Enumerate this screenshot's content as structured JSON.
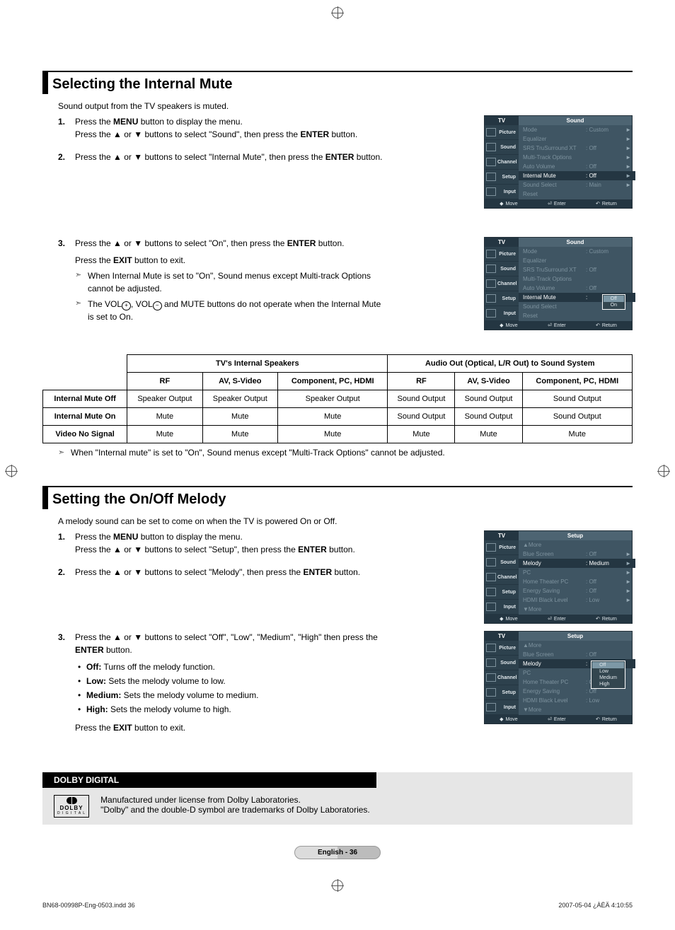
{
  "section1": {
    "title": "Selecting the Internal Mute",
    "intro": "Sound output from the TV speakers is muted.",
    "steps": {
      "s1a": "Press the ",
      "s1b": " button to display the menu.",
      "s1c": "Press the ▲ or ▼ buttons to select \"Sound\", then press the ",
      "s1d": " button.",
      "s2a": "Press the ▲ or ▼ buttons to select \"Internal Mute\", then press the ",
      "s2b": " button.",
      "s3a": "Press the ▲ or ▼ buttons to select \"On\", then press the ",
      "s3b": " button.",
      "s3c": "Press the ",
      "s3d": " button to exit.",
      "note1": "When Internal Mute is set to \"On\", Sound menus except Multi-track Options cannot be adjusted.",
      "note2a": "The VOL",
      "note2b": ", VOL",
      "note2c": " and MUTE buttons do not operate when the Internal Mute is set to On."
    }
  },
  "buttons": {
    "menu": "MENU",
    "enter": "ENTER",
    "exit": "EXIT"
  },
  "osd": {
    "tv": "TV",
    "side": [
      "Picture",
      "Sound",
      "Channel",
      "Setup",
      "Input"
    ],
    "sound_title": "Sound",
    "setup_title": "Setup",
    "sound1": {
      "items": [
        {
          "label": "Mode",
          "val": ": Custom",
          "arr": "►"
        },
        {
          "label": "Equalizer",
          "val": "",
          "arr": "►"
        },
        {
          "label": "SRS TruSurround XT",
          "val": ": Off",
          "arr": "►"
        },
        {
          "label": "Multi-Track Options",
          "val": "",
          "arr": "►"
        },
        {
          "label": "Auto Volume",
          "val": ": Off",
          "arr": "►"
        },
        {
          "label": "Internal Mute",
          "val": ": Off",
          "arr": "►",
          "hl": true
        },
        {
          "label": "Sound Select",
          "val": ": Main",
          "arr": "►"
        },
        {
          "label": "Reset",
          "val": "",
          "arr": ""
        }
      ]
    },
    "sound2": {
      "items": [
        {
          "label": "Mode",
          "val": ": Custom"
        },
        {
          "label": "Equalizer",
          "val": ""
        },
        {
          "label": "SRS TruSurround XT",
          "val": ": Off"
        },
        {
          "label": "Multi-Track Options",
          "val": ""
        },
        {
          "label": "Auto Volume",
          "val": ": Off"
        },
        {
          "label": "Internal Mute",
          "val": ":",
          "hl": true,
          "drop": [
            "Off",
            "On"
          ],
          "sel": "Off"
        },
        {
          "label": "Sound Select",
          "val": ""
        },
        {
          "label": "Reset",
          "val": ""
        }
      ]
    },
    "setup1": {
      "items": [
        {
          "label": "▲More",
          "val": ""
        },
        {
          "label": "Blue Screen",
          "val": ": Off",
          "arr": "►"
        },
        {
          "label": "Melody",
          "val": ": Medium",
          "arr": "►",
          "hl": true
        },
        {
          "label": "PC",
          "val": "",
          "arr": "►"
        },
        {
          "label": "Home Theater PC",
          "val": ": Off",
          "arr": "►"
        },
        {
          "label": "Energy Saving",
          "val": ": Off",
          "arr": "►"
        },
        {
          "label": "HDMI Black Level",
          "val": ": Low",
          "arr": "►"
        },
        {
          "label": "▼More",
          "val": ""
        }
      ]
    },
    "setup2": {
      "items": [
        {
          "label": "▲More",
          "val": ""
        },
        {
          "label": "Blue Screen",
          "val": ": Off"
        },
        {
          "label": "Melody",
          "val": ":",
          "hl": true,
          "drop": [
            "Off",
            "Low",
            "Medium",
            "High"
          ],
          "sel": "Off"
        },
        {
          "label": "PC",
          "val": ""
        },
        {
          "label": "Home Theater PC",
          "val": ": Off"
        },
        {
          "label": "Energy Saving",
          "val": ": Off"
        },
        {
          "label": "HDMI Black Level",
          "val": ": Low"
        },
        {
          "label": "▼More",
          "val": ""
        }
      ]
    },
    "footer": {
      "move": "Move",
      "enter": "Enter",
      "return": "Return"
    }
  },
  "table": {
    "grp1": "TV's Internal Speakers",
    "grp2": "Audio Out (Optical, L/R Out) to Sound System",
    "cols": [
      "RF",
      "AV, S-Video",
      "Component, PC, HDMI",
      "RF",
      "AV, S-Video",
      "Component, PC, HDMI"
    ],
    "rows": [
      {
        "hdr": "Internal Mute Off",
        "cells": [
          "Speaker Output",
          "Speaker Output",
          "Speaker Output",
          "Sound Output",
          "Sound Output",
          "Sound Output"
        ]
      },
      {
        "hdr": "Internal Mute On",
        "cells": [
          "Mute",
          "Mute",
          "Mute",
          "Sound Output",
          "Sound Output",
          "Sound Output"
        ]
      },
      {
        "hdr": "Video No Signal",
        "cells": [
          "Mute",
          "Mute",
          "Mute",
          "Mute",
          "Mute",
          "Mute"
        ]
      }
    ],
    "note": "When \"Internal mute\" is set to \"On\", Sound menus except \"Multi-Track Options\" cannot be adjusted."
  },
  "section2": {
    "title": "Setting the On/Off Melody",
    "intro": "A melody sound can be set to come on when the TV is powered On or Off.",
    "steps": {
      "s1a": "Press the ",
      "s1b": " button to display the menu.",
      "s1c": "Press the ▲ or ▼ buttons to select \"Setup\", then press the ",
      "s1d": " button.",
      "s2a": "Press the ▲ or ▼ buttons to select \"Melody\", then press the ",
      "s2b": " button.",
      "s3a": "Press the ▲ or ▼ buttons to select \"Off\", \"Low\", \"Medium\", \"High\" then press the ",
      "s3b": " button.",
      "s3c": "Press the ",
      "s3d": " button to exit.",
      "opts": [
        {
          "k": "Off:",
          "v": " Turns off the melody function."
        },
        {
          "k": "Low:",
          "v": " Sets the melody volume to low."
        },
        {
          "k": "Medium:",
          "v": " Sets the melody volume to medium."
        },
        {
          "k": "High:",
          "v": " Sets the melody volume to high."
        }
      ]
    }
  },
  "dolby": {
    "head": "DOLBY DIGITAL",
    "logo1": "DOLBY",
    "logo2": "D I G I T A L",
    "line1": "Manufactured under license from Dolby Laboratories.",
    "line2": "\"Dolby\" and the double-D symbol are trademarks of Dolby Laboratories."
  },
  "page_num": "English - 36",
  "doc_footer": {
    "left": "BN68-00998P-Eng-0503.indd   36",
    "right": "2007-05-04   ¿ÀÈÄ 4:10:55"
  }
}
